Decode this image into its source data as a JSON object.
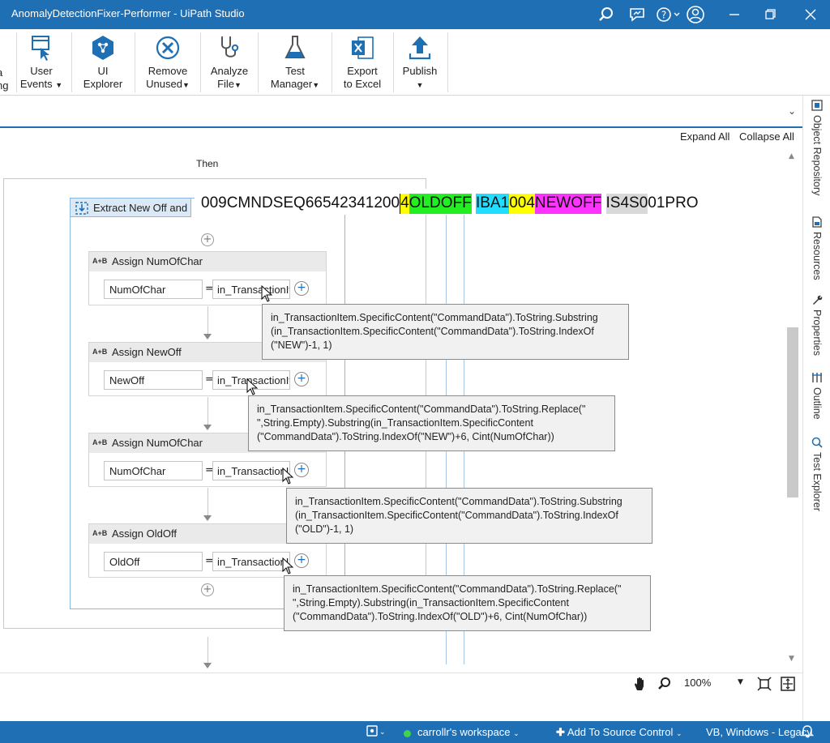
{
  "window": {
    "title": "AnomalyDetectionFixer-Performer - UiPath Studio"
  },
  "ribbon": {
    "partial_label_1": "a",
    "partial_label_2": "ng",
    "user_events_1": "User",
    "user_events_2": "Events",
    "ui_explorer_1": "UI",
    "ui_explorer_2": "Explorer",
    "remove_unused_1": "Remove",
    "remove_unused_2": "Unused",
    "analyze_file_1": "Analyze",
    "analyze_file_2": "File",
    "test_manager_1": "Test",
    "test_manager_2": "Manager",
    "export_excel_1": "Export",
    "export_excel_2": "to Excel",
    "publish": "Publish"
  },
  "designer": {
    "expand_all": "Expand All",
    "collapse_all": "Collapse All",
    "then_label": "Then",
    "sequence_title": "Extract New Off and",
    "assigns": [
      {
        "title": "Assign NumOfChar",
        "variable": "NumOfChar",
        "value": "in_TransactionIt"
      },
      {
        "title": "Assign NewOff",
        "variable": "NewOff",
        "value": "in_TransactionIt"
      },
      {
        "title": "Assign NumOfChar",
        "variable": "NumOfChar",
        "value": "in_TransactionI"
      },
      {
        "title": "Assign OldOff",
        "variable": "OldOff",
        "value": "in_TransactionI"
      }
    ],
    "assign_badge": "A+B",
    "equals": "="
  },
  "command_text": {
    "seg1": "009CMNDSEQ665423412",
    "seg2": "00",
    "seg3": "4",
    "seg4": "OLDOFF",
    "seg5": " ",
    "seg6": "IBA1",
    "seg7": "00",
    "seg8": "4",
    "seg9": "NEWOFF",
    "seg10": " ",
    "seg11": "IS4S0",
    "seg12": "01PRO",
    "colors": {
      "yellow": "#ffff00",
      "green": "#22ee22",
      "cyan": "#22ddff",
      "magenta": "#ff33ff",
      "gray": "#d9d9d9"
    }
  },
  "tooltips": [
    {
      "lines": [
        "in_TransactionItem.SpecificContent(\"CommandData\").ToString.Substring",
        "(in_TransactionItem.SpecificContent(\"CommandData\").ToString.IndexOf",
        "(\"NEW\")-1, 1)"
      ]
    },
    {
      "lines": [
        "in_TransactionItem.SpecificContent(\"CommandData\").ToString.Replace(\"",
        "\",String.Empty).Substring(in_TransactionItem.SpecificContent",
        "(\"CommandData\").ToString.IndexOf(\"NEW\")+6, Cint(NumOfChar))"
      ]
    },
    {
      "lines": [
        "in_TransactionItem.SpecificContent(\"CommandData\").ToString.Substring",
        "(in_TransactionItem.SpecificContent(\"CommandData\").ToString.IndexOf",
        "(\"OLD\")-1, 1)"
      ]
    },
    {
      "lines": [
        "in_TransactionItem.SpecificContent(\"CommandData\").ToString.Replace(\"",
        "\",String.Empty).Substring(in_TransactionItem.SpecificContent",
        "(\"CommandData\").ToString.IndexOf(\"OLD\")+6, Cint(NumOfChar))"
      ]
    }
  ],
  "side_panel": {
    "object_repository": "Object Repository",
    "resources": "Resources",
    "properties": "Properties",
    "outline": "Outline",
    "test_explorer": "Test Explorer"
  },
  "zoom": {
    "level": "100%"
  },
  "status": {
    "workspace": "carrollr's workspace",
    "source_control": "Add To Source Control",
    "language": "VB, Windows - Legacy"
  },
  "colors": {
    "accent": "#1f6fb5",
    "workspace_dot": "#3fd14f"
  }
}
